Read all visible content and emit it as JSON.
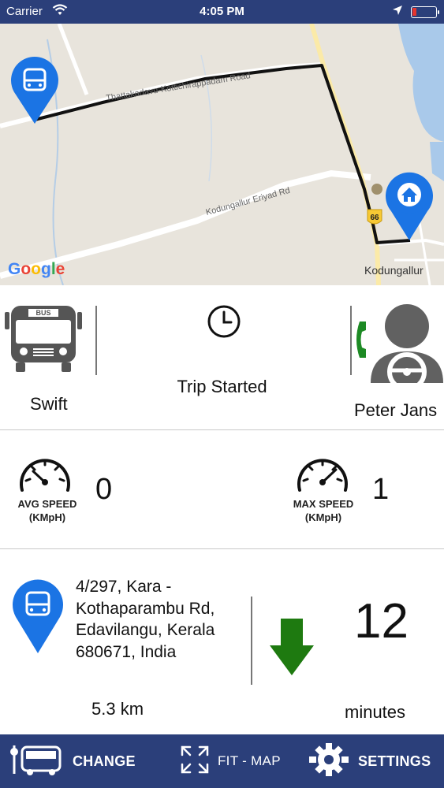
{
  "status_bar": {
    "carrier": "Carrier",
    "time": "4:05 PM"
  },
  "map": {
    "road_label_1": "Thattakadavu-Kottichirappadam Road",
    "road_label_2": "Kodungallur Eriyad Rd",
    "highway_shield": "66",
    "place_label": "Kodungallur",
    "google_logo": "Google",
    "icons": [
      "bus-pin-icon",
      "home-pin-icon"
    ],
    "colors": {
      "land": "#e7e3dc",
      "water": "#a8c8e8",
      "route": "#111111",
      "pin": "#1b74e4"
    }
  },
  "trip_info": {
    "bus_name": "Swift",
    "bus_icon_text": "BUS",
    "status": "Trip Started",
    "driver_name": "Peter Jans"
  },
  "speed": {
    "avg_label": "AVG SPEED",
    "avg_unit": "(KMpH)",
    "avg_value": "0",
    "max_label": "MAX SPEED",
    "max_unit": "(KMpH)",
    "max_value": "1"
  },
  "location": {
    "address_line1": "4/297, Kara -",
    "address_line2": "Kothaparambu Rd,",
    "address_line3": "Edavilangu, Kerala",
    "address_line4": "680671, India",
    "distance": "5.3 km",
    "eta_value": "12",
    "eta_unit": "minutes",
    "direction_color": "#1e7a10"
  },
  "bottom_bar": {
    "change_label": "CHANGE",
    "fit_map_label": "FIT - MAP",
    "settings_label": "SETTINGS",
    "bar_color": "#2b3f7a"
  }
}
